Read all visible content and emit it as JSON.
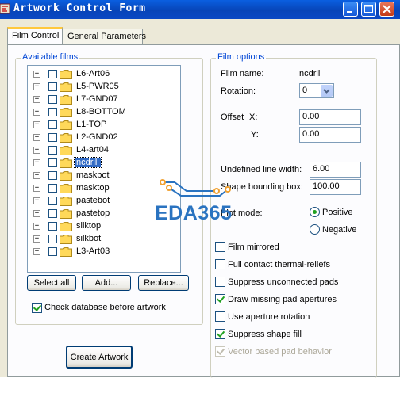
{
  "window": {
    "title": "Artwork Control Form"
  },
  "tabs": [
    {
      "label": "Film Control",
      "active": true
    },
    {
      "label": "General Parameters",
      "active": false
    }
  ],
  "available_films": {
    "legend": "Available films",
    "items": [
      {
        "label": "L6-Art06",
        "selected": false
      },
      {
        "label": "L5-PWR05",
        "selected": false
      },
      {
        "label": "L7-GND07",
        "selected": false
      },
      {
        "label": "L8-BOTTOM",
        "selected": false
      },
      {
        "label": "L1-TOP",
        "selected": false
      },
      {
        "label": "L2-GND02",
        "selected": false
      },
      {
        "label": "L4-art04",
        "selected": false
      },
      {
        "label": "ncdrill",
        "selected": true
      },
      {
        "label": "maskbot",
        "selected": false
      },
      {
        "label": "masktop",
        "selected": false
      },
      {
        "label": "pastebot",
        "selected": false
      },
      {
        "label": "pastetop",
        "selected": false
      },
      {
        "label": "silktop",
        "selected": false
      },
      {
        "label": "silkbot",
        "selected": false
      },
      {
        "label": "L3-Art03",
        "selected": false
      }
    ],
    "buttons": {
      "select_all": "Select all",
      "add": "Add...",
      "replace": "Replace..."
    },
    "check_database": {
      "label": "Check database before artwork",
      "checked": true
    }
  },
  "create_artwork_label": "Create Artwork",
  "film_options": {
    "legend": "Film options",
    "film_name_label": "Film name:",
    "film_name_value": "ncdrill",
    "rotation_label": "Rotation:",
    "rotation_value": "0",
    "offset_label": "Offset",
    "offset_x_label": "X:",
    "offset_x_value": "0.00",
    "offset_y_label": "Y:",
    "offset_y_value": "0.00",
    "undefined_line_width_label": "Undefined line width:",
    "undefined_line_width_value": "6.00",
    "shape_bounding_box_label": "Shape bounding box:",
    "shape_bounding_box_value": "100.00",
    "plot_mode_label": "Plot mode:",
    "plot_mode_options": [
      {
        "label": "Positive",
        "selected": true
      },
      {
        "label": "Negative",
        "selected": false
      }
    ],
    "checkboxes": [
      {
        "label": "Film mirrored",
        "checked": false,
        "enabled": true
      },
      {
        "label": "Full contact thermal-reliefs",
        "checked": false,
        "enabled": true
      },
      {
        "label": "Suppress unconnected pads",
        "checked": false,
        "enabled": true
      },
      {
        "label": "Draw missing pad apertures",
        "checked": true,
        "enabled": true
      },
      {
        "label": "Use aperture rotation",
        "checked": false,
        "enabled": true
      },
      {
        "label": "Suppress shape fill",
        "checked": true,
        "enabled": true
      },
      {
        "label": "Vector based pad behavior",
        "checked": true,
        "enabled": false
      }
    ]
  },
  "watermark": {
    "text": "EDA365"
  },
  "colors": {
    "titlebar": "#0a5fe0",
    "dialog_bg": "#ece9d8",
    "group_legend": "#0046d5",
    "selection": "#316ac5",
    "watermark_text": "#2a73c0",
    "watermark_circuit": "#f0a030"
  },
  "icons": {
    "app": "app-icon",
    "minimize": "minimize-icon",
    "maximize": "maximize-icon",
    "close": "close-icon",
    "tree_expand": "plus-expander-icon",
    "folder": "folder-icon",
    "dropdown": "chevron-down-icon"
  }
}
